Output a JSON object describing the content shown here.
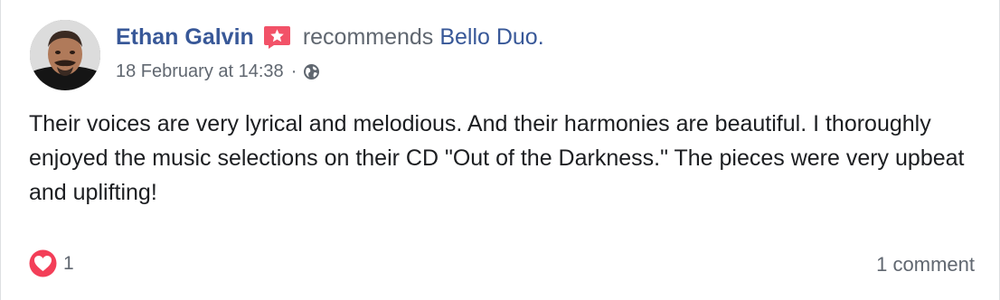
{
  "post": {
    "author": "Ethan Galvin",
    "verb": "recommends",
    "page_name": "Bello Duo.",
    "timestamp": "18 February at 14:38",
    "separator": "·",
    "audience_icon": "globe-icon",
    "recommendation_icon": "recommend-star-icon",
    "body": "Their voices are very lyrical and melodious. And their harmonies are beautiful. I thoroughly enjoyed the music selections on their CD \"Out of the Darkness.\" The pieces were very upbeat and uplifting!",
    "reactions": {
      "icon": "heart-reaction-icon",
      "count": "1"
    },
    "comments_label": "1 comment"
  },
  "colors": {
    "link": "#385898",
    "secondary_text": "#606770",
    "body_text": "#1c1e21",
    "recommend_badge": "#f25268",
    "love_reaction": "#f33e58"
  }
}
